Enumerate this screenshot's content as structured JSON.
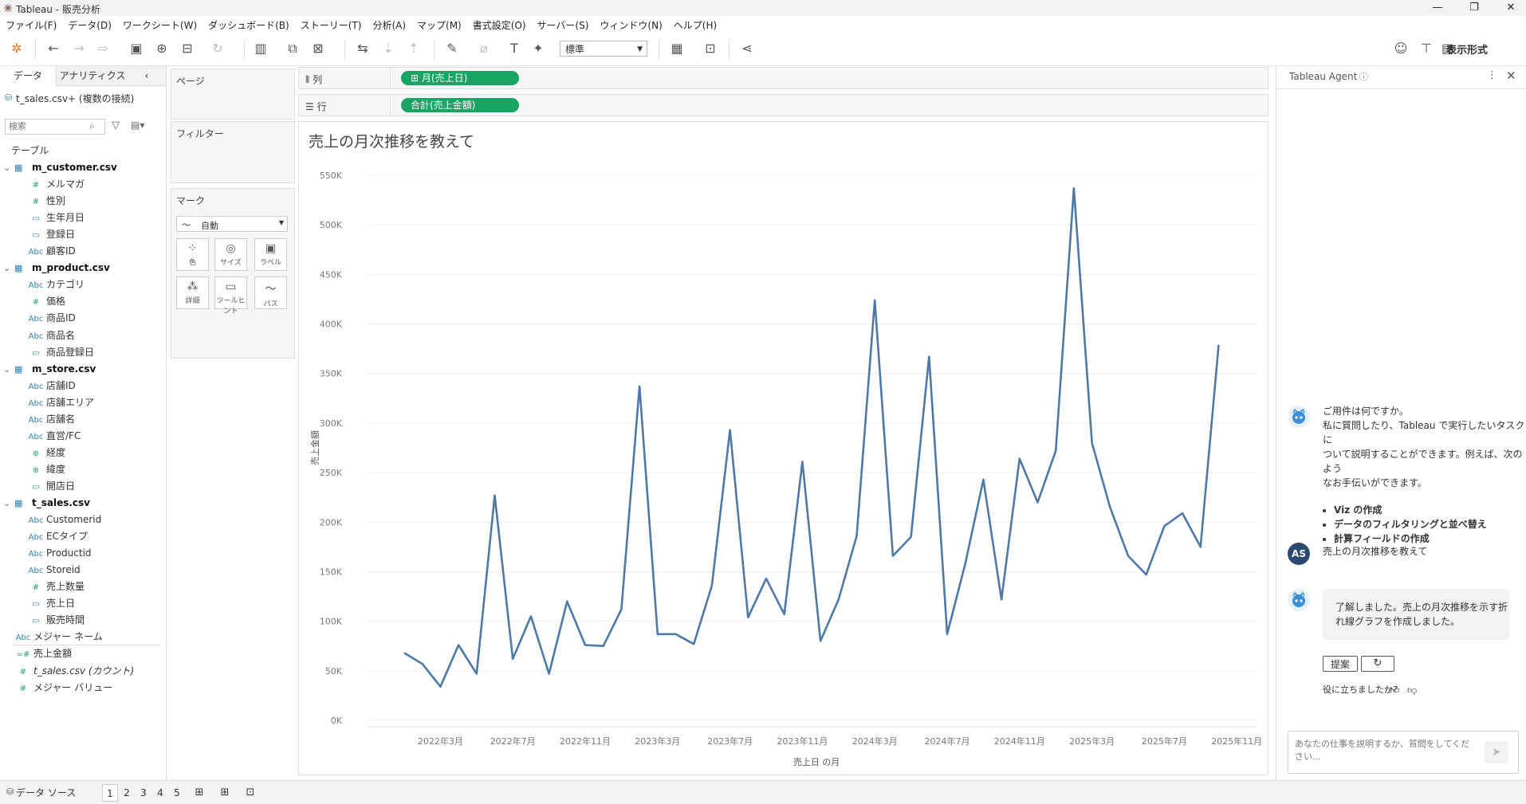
{
  "window": {
    "title": "Tableau - 販売分析",
    "controls": {
      "minimize": "—",
      "restore": "❐",
      "close": "✕"
    }
  },
  "menu": [
    "ファイル(F)",
    "データ(D)",
    "ワークシート(W)",
    "ダッシュボード(B)",
    "ストーリー(T)",
    "分析(A)",
    "マップ(M)",
    "書式設定(O)",
    "サーバー(S)",
    "ウィンドウ(N)",
    "ヘルプ(H)"
  ],
  "toolbar": {
    "fit_select": "標準",
    "display_format": "表示形式"
  },
  "left_panel": {
    "tabs": [
      "データ",
      "アナリティクス"
    ],
    "collapse": "‹",
    "datasource": "t_sales.csv+ (複数の接続)",
    "search_placeholder": "検索",
    "section_label": "テーブル",
    "rows": [
      {
        "type": "table",
        "label": "m_customer.csv"
      },
      {
        "type": "num",
        "icon": "#",
        "label": "メルマガ"
      },
      {
        "type": "num",
        "icon": "#",
        "label": "性別"
      },
      {
        "type": "date",
        "icon": "▭",
        "label": "生年月日"
      },
      {
        "type": "date",
        "icon": "▭",
        "label": "登録日"
      },
      {
        "type": "text",
        "icon": "Abc",
        "label": "顧客ID"
      },
      {
        "type": "table",
        "label": "m_product.csv"
      },
      {
        "type": "text",
        "icon": "Abc",
        "label": "カテゴリ"
      },
      {
        "type": "num",
        "icon": "#",
        "label": "価格"
      },
      {
        "type": "text",
        "icon": "Abc",
        "label": "商品ID"
      },
      {
        "type": "text",
        "icon": "Abc",
        "label": "商品名"
      },
      {
        "type": "date",
        "icon": "▭",
        "label": "商品登録日"
      },
      {
        "type": "table",
        "label": "m_store.csv"
      },
      {
        "type": "text",
        "icon": "Abc",
        "label": "店舗ID"
      },
      {
        "type": "text",
        "icon": "Abc",
        "label": "店舗エリア"
      },
      {
        "type": "text",
        "icon": "Abc",
        "label": "店舗名"
      },
      {
        "type": "text",
        "icon": "Abc",
        "label": "直営/FC"
      },
      {
        "type": "geo",
        "icon": "⊕",
        "label": "経度"
      },
      {
        "type": "geo",
        "icon": "⊕",
        "label": "緯度"
      },
      {
        "type": "date",
        "icon": "▭",
        "label": "開店日"
      },
      {
        "type": "table",
        "label": "t_sales.csv"
      },
      {
        "type": "text",
        "icon": "Abc",
        "label": "Customerid"
      },
      {
        "type": "text",
        "icon": "Abc",
        "label": "ECタイプ"
      },
      {
        "type": "text",
        "icon": "Abc",
        "label": "Productid"
      },
      {
        "type": "text",
        "icon": "Abc",
        "label": "Storeid"
      },
      {
        "type": "num",
        "icon": "#",
        "label": "売上数量"
      },
      {
        "type": "date",
        "icon": "▭",
        "label": "売上日"
      },
      {
        "type": "date",
        "icon": "▭",
        "label": "販売時間"
      },
      {
        "type": "measurename",
        "icon": "Abc",
        "label": "メジャー ネーム"
      },
      {
        "type": "measure",
        "icon": "=#",
        "label": "売上金額"
      },
      {
        "type": "measure",
        "icon": "#",
        "label": "t_sales.csv (カウント)"
      },
      {
        "type": "measure",
        "icon": "#",
        "label": "メジャー バリュー"
      }
    ]
  },
  "shelves": {
    "pages": "ページ",
    "filters": "フィルター",
    "marks": "マーク",
    "marks_type": "自動",
    "mark_buttons": [
      "色",
      "サイズ",
      "ラベル",
      "詳細",
      "ツールヒント",
      "パス"
    ],
    "columns_label": "列",
    "rows_label": "行",
    "columns_pill": "月(売上日)",
    "rows_pill": "合計(売上金額)"
  },
  "chart_data": {
    "type": "line",
    "title": "売上の月次推移を教えて",
    "xlabel": "売上日 の月",
    "ylabel": "売上金額",
    "ylim": [
      0,
      550000
    ],
    "yticks": [
      0,
      50000,
      100000,
      150000,
      200000,
      250000,
      300000,
      350000,
      400000,
      450000,
      500000,
      550000
    ],
    "ytick_labels": [
      "0K",
      "50K",
      "100K",
      "150K",
      "200K",
      "250K",
      "300K",
      "350K",
      "400K",
      "450K",
      "500K",
      "550K"
    ],
    "xtick_labels": [
      "2022年3月",
      "2022年7月",
      "2022年11月",
      "2023年3月",
      "2023年7月",
      "2023年11月",
      "2024年3月",
      "2024年7月",
      "2024年11月",
      "2025年3月",
      "2025年7月",
      "2025年11月"
    ],
    "x": [
      "2022-01",
      "2022-02",
      "2022-03",
      "2022-04",
      "2022-05",
      "2022-06",
      "2022-07",
      "2022-08",
      "2022-09",
      "2022-10",
      "2022-11",
      "2022-12",
      "2023-01",
      "2023-02",
      "2023-03",
      "2023-04",
      "2023-05",
      "2023-06",
      "2023-07",
      "2023-08",
      "2023-09",
      "2023-10",
      "2023-11",
      "2023-12",
      "2024-01",
      "2024-02",
      "2024-03",
      "2024-04",
      "2024-05",
      "2024-06",
      "2024-07",
      "2024-08",
      "2024-09",
      "2024-10",
      "2024-11",
      "2024-12",
      "2025-01",
      "2025-02",
      "2025-03",
      "2025-04",
      "2025-05",
      "2025-06",
      "2025-07",
      "2025-08",
      "2025-09",
      "2025-10",
      "2025-11",
      "2025-12"
    ],
    "values": [
      68000,
      57000,
      34000,
      76000,
      47000,
      227000,
      62000,
      105000,
      47000,
      120000,
      76000,
      75000,
      112000,
      337000,
      87000,
      87000,
      77000,
      136000,
      293000,
      104000,
      143000,
      107000,
      261000,
      80000,
      122000,
      186000,
      424000,
      166000,
      185000,
      367000,
      87000,
      158000,
      243000,
      122000,
      264000,
      220000,
      272000,
      537000,
      280000,
      215000,
      166000,
      147000,
      196000,
      209000,
      175000,
      379000
    ],
    "line_color": "#4e79a7",
    "grid": true
  },
  "agent": {
    "title": "Tableau Agent",
    "info": "ⓘ",
    "greeting_lines": [
      "ご用件は何ですか。",
      "私に質問したり、Tableau で実行したいタスクに",
      "ついて説明することができます。例えば、次のよう",
      "なお手伝いができます。"
    ],
    "bullets": [
      "Viz の作成",
      "データのフィルタリングと並べ替え",
      "計算フィールドの作成"
    ],
    "user_initials": "AS",
    "user_message": "売上の月次推移を教えて",
    "reply_lines": [
      "了解しました。売上の月次推移を示す折",
      "れ線グラフを作成しました。"
    ],
    "suggest_button": "提案",
    "feedback_label": "役に立ちましたか?",
    "input_placeholder": "あなたの仕事を説明するか、質問をしてください..."
  },
  "status": {
    "datasource_tab": "データ ソース",
    "sheet_tabs": [
      "1",
      "2",
      "3",
      "4",
      "5"
    ]
  },
  "colors": {
    "accent_green": "#19a463",
    "line_blue": "#4e79a7",
    "agent_icon": "#3b8fd6",
    "avatar_dark": "#2c4a6e"
  }
}
